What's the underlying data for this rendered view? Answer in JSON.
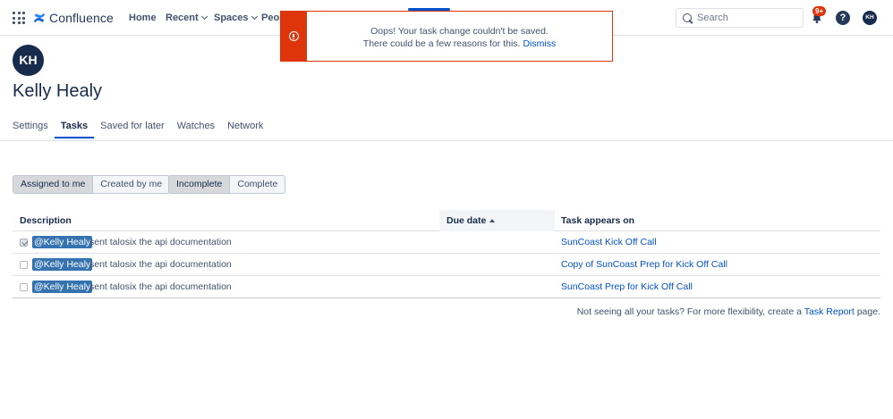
{
  "nav": {
    "logo_text": "Confluence",
    "items": [
      {
        "label": "Home",
        "dropdown": false
      },
      {
        "label": "Recent",
        "dropdown": true
      },
      {
        "label": "Spaces",
        "dropdown": true
      },
      {
        "label": "Peop",
        "dropdown": false
      }
    ],
    "search_placeholder": "Search",
    "notifications_badge": "9+",
    "help_label": "?",
    "user_initials": "KH"
  },
  "flag": {
    "line1": "Oops! Your task change couldn't be saved.",
    "line2": "There could be a few reasons for this.",
    "dismiss": "Dismiss",
    "color": "#de350b"
  },
  "profile": {
    "initials": "KH",
    "name": "Kelly Healy"
  },
  "tabs": [
    {
      "label": "Settings",
      "active": false
    },
    {
      "label": "Tasks",
      "active": true
    },
    {
      "label": "Saved for later",
      "active": false
    },
    {
      "label": "Watches",
      "active": false
    },
    {
      "label": "Network",
      "active": false
    }
  ],
  "filters": {
    "assignment": [
      {
        "label": "Assigned to me",
        "selected": true
      },
      {
        "label": "Created by me",
        "selected": false
      }
    ],
    "status": [
      {
        "label": "Incomplete",
        "selected": true
      },
      {
        "label": "Complete",
        "selected": false
      }
    ]
  },
  "table": {
    "columns": {
      "description": "Description",
      "due_date": "Due date",
      "appears_on": "Task appears on"
    },
    "rows": [
      {
        "checked": true,
        "mention": "@Kelly Healy",
        "text": "sent talosix the api documentation",
        "appears_on": "SunCoast Kick Off Call"
      },
      {
        "checked": false,
        "mention": "@Kelly Healy",
        "text": "sent talosix the api documentation",
        "appears_on": "Copy of SunCoast Prep for Kick Off Call"
      },
      {
        "checked": false,
        "mention": "@Kelly Healy",
        "text": "sent talosix the api documentation",
        "appears_on": "SunCoast Prep for Kick Off Call"
      }
    ]
  },
  "footer": {
    "prefix": "Not seeing all your tasks? For more flexibility, create a",
    "link": "Task Report",
    "suffix": "page."
  },
  "colors": {
    "accent": "#0052cc",
    "error": "#de350b",
    "mention_bg": "#3572b0",
    "dark": "#172b4d"
  }
}
